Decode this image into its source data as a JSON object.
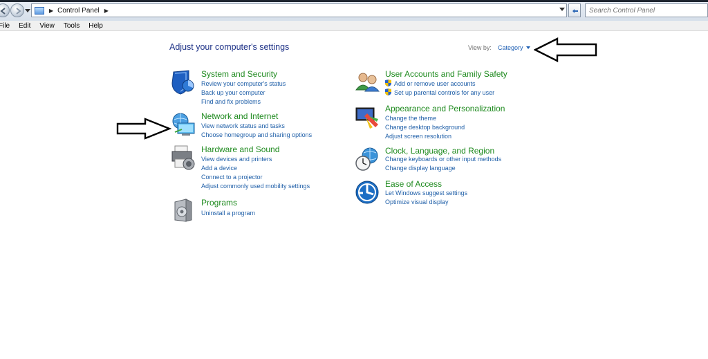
{
  "address_bar": {
    "path": "Control Panel"
  },
  "search": {
    "placeholder": "Search Control Panel"
  },
  "menu": [
    "File",
    "Edit",
    "View",
    "Tools",
    "Help"
  ],
  "main": {
    "title": "Adjust your computer's settings",
    "view_by_label": "View by:",
    "view_by_value": "Category"
  },
  "categories": {
    "system_security": {
      "title": "System and Security",
      "links": [
        "Review your computer's status",
        "Back up your computer",
        "Find and fix problems"
      ]
    },
    "network_internet": {
      "title": "Network and Internet",
      "links": [
        "View network status and tasks",
        "Choose homegroup and sharing options"
      ]
    },
    "hardware_sound": {
      "title": "Hardware and Sound",
      "links": [
        "View devices and printers",
        "Add a device",
        "Connect to a projector",
        "Adjust commonly used mobility settings"
      ]
    },
    "programs": {
      "title": "Programs",
      "links": [
        "Uninstall a program"
      ]
    },
    "user_accounts": {
      "title": "User Accounts and Family Safety",
      "links": [
        "Add or remove user accounts",
        "Set up parental controls for any user"
      ]
    },
    "appearance": {
      "title": "Appearance and Personalization",
      "links": [
        "Change the theme",
        "Change desktop background",
        "Adjust screen resolution"
      ]
    },
    "clock_language": {
      "title": "Clock, Language, and Region",
      "links": [
        "Change keyboards or other input methods",
        "Change display language"
      ]
    },
    "ease_access": {
      "title": "Ease of Access",
      "links": [
        "Let Windows suggest settings",
        "Optimize visual display"
      ]
    }
  },
  "colors": {
    "category_title": "#1e8a1e",
    "link": "#1f5fa8",
    "heading": "#1e3287"
  }
}
